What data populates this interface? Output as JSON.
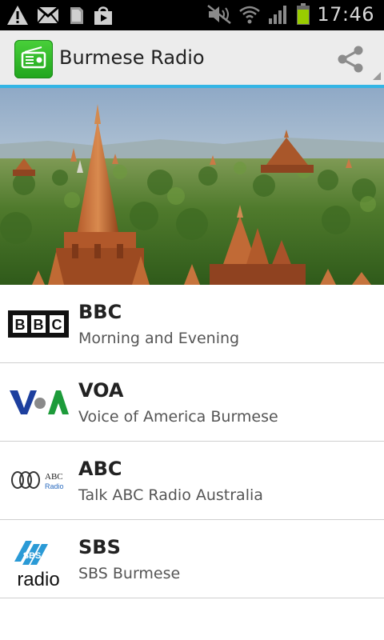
{
  "status_bar": {
    "time": "17:46",
    "icons": [
      "warning-icon",
      "gmail-icon",
      "notification-icon",
      "shopping-bag-icon",
      "mute-icon",
      "wifi-icon",
      "signal-icon",
      "battery-icon"
    ]
  },
  "app_bar": {
    "title": "Burmese Radio",
    "icons": [
      "radio-icon",
      "share-icon"
    ]
  },
  "stations": [
    {
      "title": "BBC",
      "subtitle": "Morning and Evening",
      "logo": "bbc-logo",
      "logo_text": "BBC"
    },
    {
      "title": "VOA",
      "subtitle": "Voice of America Burmese",
      "logo": "voa-logo",
      "logo_text": "VOA"
    },
    {
      "title": "ABC",
      "subtitle": "Talk ABC Radio Australia",
      "logo": "abc-logo",
      "logo_text": "ABC Radio"
    },
    {
      "title": "SBS",
      "subtitle": "SBS Burmese",
      "logo": "sbs-logo",
      "logo_text": "SBS radio"
    }
  ],
  "colors": {
    "accent": "#33b5e5",
    "app_icon": "#2db52a",
    "action_bar": "#ececec"
  }
}
